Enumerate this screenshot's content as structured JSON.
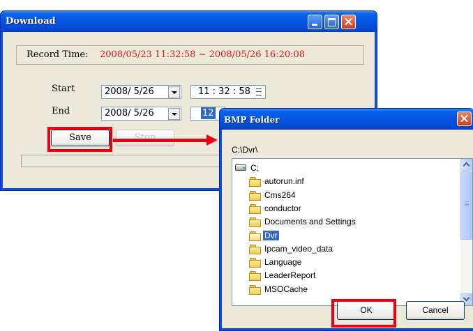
{
  "download": {
    "title": "Download",
    "record_time_label": "Record Time:",
    "record_time_value": "2008/05/23 11:32:58 ~ 2008/05/26 16:20:08",
    "start_label": "Start",
    "start_date": "2008/ 5/26",
    "start_time": "11 : 32 : 58",
    "end_label": "End",
    "end_date": "2008/ 5/26",
    "end_time_hour": "12",
    "save_label": "Save",
    "stop_label": "Stop",
    "progress": 0
  },
  "bmp_folder": {
    "title": "BMP Folder",
    "path": "C:\\Dvr\\",
    "tree": [
      {
        "label": "C:",
        "icon": "drive-icon"
      },
      {
        "label": "autorun.inf",
        "icon": "folder-icon"
      },
      {
        "label": "Cms264",
        "icon": "folder-icon"
      },
      {
        "label": "conductor",
        "icon": "folder-icon"
      },
      {
        "label": "Documents and Settings",
        "icon": "folder-icon"
      },
      {
        "label": "Dvr",
        "icon": "open-folder-icon",
        "selected": true
      },
      {
        "label": "Ipcam_video_data",
        "icon": "folder-icon"
      },
      {
        "label": "Language",
        "icon": "folder-icon"
      },
      {
        "label": "LeaderReport",
        "icon": "folder-icon"
      },
      {
        "label": "MSOCache",
        "icon": "folder-icon"
      }
    ],
    "ok_label": "OK",
    "cancel_label": "Cancel"
  },
  "annotations": {
    "highlight_color": "#e60012",
    "highlighted": [
      "Save",
      "OK"
    ]
  }
}
